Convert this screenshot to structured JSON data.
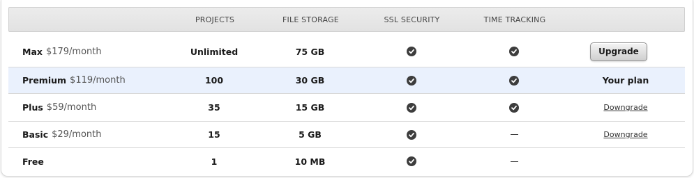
{
  "header": {
    "projects": "PROJECTS",
    "file_storage": "FILE STORAGE",
    "ssl_security": "SSL SECURITY",
    "time_tracking": "TIME TRACKING"
  },
  "plans": [
    {
      "name": "Max",
      "price": "$179/month",
      "projects": "Unlimited",
      "storage": "75 GB",
      "ssl": "check-icon",
      "time_tracking": "check-icon",
      "action": "Upgrade"
    },
    {
      "name": "Premium",
      "price": "$119/month",
      "projects": "100",
      "storage": "30 GB",
      "ssl": "check-icon",
      "time_tracking": "check-icon",
      "action": "Your plan"
    },
    {
      "name": "Plus",
      "price": "$59/month",
      "projects": "35",
      "storage": "15 GB",
      "ssl": "check-icon",
      "time_tracking": "check-icon",
      "action": "Downgrade"
    },
    {
      "name": "Basic",
      "price": "$29/month",
      "projects": "15",
      "storage": "5 GB",
      "ssl": "check-icon",
      "time_tracking": "dash",
      "action": "Downgrade"
    },
    {
      "name": "Free",
      "price": "",
      "projects": "1",
      "storage": "10 MB",
      "ssl": "check-icon",
      "time_tracking": "dash",
      "action": ""
    }
  ],
  "colors": {
    "current_row_bg": "#eaf1fd",
    "header_bg": "#e6e6e6",
    "check_bg": "#3d3d3d"
  }
}
